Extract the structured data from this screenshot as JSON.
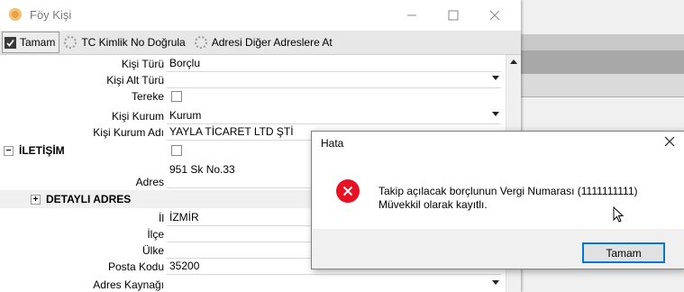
{
  "window": {
    "title": "Föy Kişi"
  },
  "toolbar": {
    "ok_label": "Tamam",
    "verify_label": "TC Kimlik No Doğrula",
    "address_label": "Adresi Diğer Adreslere At"
  },
  "form": {
    "kisi_turu": {
      "label": "Kişi Türü",
      "value": "Borçlu"
    },
    "kisi_alt_turu": {
      "label": "Kişi Alt Türü",
      "value": ""
    },
    "tereke": {
      "label": "Tereke",
      "checked": false
    },
    "kisi_kurum": {
      "label": "Kişi Kurum",
      "value": "Kurum"
    },
    "kisi_kurum_adi": {
      "label": "Kişi Kurum Adı",
      "value": "YAYLA TİCARET LTD ŞTİ"
    },
    "iletisim": {
      "label": "İLETİŞİM"
    },
    "adres": {
      "label": "Adres",
      "value": "951 Sk No.33"
    },
    "detayli_adres": {
      "label": "DETAYLI ADRES"
    },
    "il": {
      "label": "İl",
      "value": "İZMİR"
    },
    "ilce": {
      "label": "İlçe",
      "value": ""
    },
    "ulke": {
      "label": "Ülke",
      "value": ""
    },
    "posta_kodu": {
      "label": "Posta Kodu",
      "value": "35200"
    },
    "adres_kaynagi": {
      "label": "Adres Kaynağı",
      "value": ""
    }
  },
  "dialog": {
    "title": "Hata",
    "message_line1": "Takip açılacak borçlunun Vergi Numarası (1111111111)",
    "message_line2": "Müvekkil olarak kayıtlı.",
    "ok_label": "Tamam",
    "icon": "error-icon",
    "icon_color": "#e81123"
  }
}
